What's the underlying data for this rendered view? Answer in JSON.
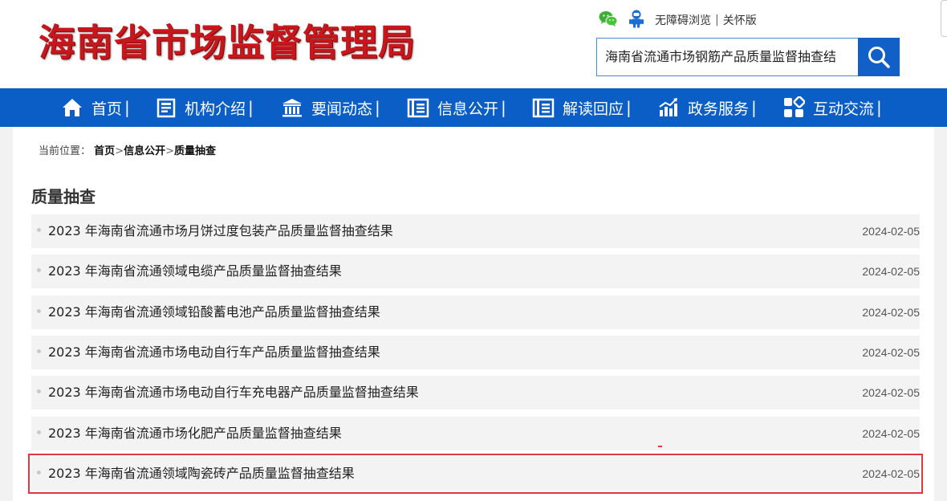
{
  "header": {
    "logo_text": "海南省市场监督管理局",
    "links": {
      "accessibility": "无障碍浏览",
      "separator": "|",
      "elder": "关怀版"
    }
  },
  "search": {
    "value": "海南省流通市场钢筋产品质量监督抽查结"
  },
  "nav": {
    "items": [
      {
        "label": "首页",
        "icon": "home-icon"
      },
      {
        "label": "机构介绍",
        "icon": "document-icon"
      },
      {
        "label": "要闻动态",
        "icon": "building-icon"
      },
      {
        "label": "信息公开",
        "icon": "list-icon"
      },
      {
        "label": "解读回应",
        "icon": "list-icon"
      },
      {
        "label": "政务服务",
        "icon": "chart-icon"
      },
      {
        "label": "互动交流",
        "icon": "grid-icon"
      }
    ],
    "separator": "|"
  },
  "breadcrumb": {
    "prefix": "当前位置：",
    "items": [
      "首页",
      "信息公开",
      "质量抽查"
    ],
    "separator": ">"
  },
  "section": {
    "title": "质量抽查"
  },
  "list": [
    {
      "title": "2023 年海南省流通市场月饼过度包装产品质量监督抽查结果",
      "date": "2024-02-05"
    },
    {
      "title": "2023 年海南省流通领域电缆产品质量监督抽查结果",
      "date": "2024-02-05"
    },
    {
      "title": "2023 年海南省流通领域铅酸蓄电池产品质量监督抽查结果",
      "date": "2024-02-05"
    },
    {
      "title": "2023 年海南省流通市场电动自行车产品质量监督抽查结果",
      "date": "2024-02-05"
    },
    {
      "title": "2023 年海南省流通市场电动自行车充电器产品质量监督抽查结果",
      "date": "2024-02-05"
    },
    {
      "title": "2023 年海南省流通市场化肥产品质量监督抽查结果",
      "date": "2024-02-05"
    },
    {
      "title": "2023 年海南省流通领域陶瓷砖产品质量监督抽查结果",
      "date": "2024-02-05"
    }
  ],
  "colors": {
    "brand_red": "#c8161d",
    "nav_blue": "#0b5ec5",
    "search_blue": "#1060c8",
    "highlight": "#e0383e"
  }
}
